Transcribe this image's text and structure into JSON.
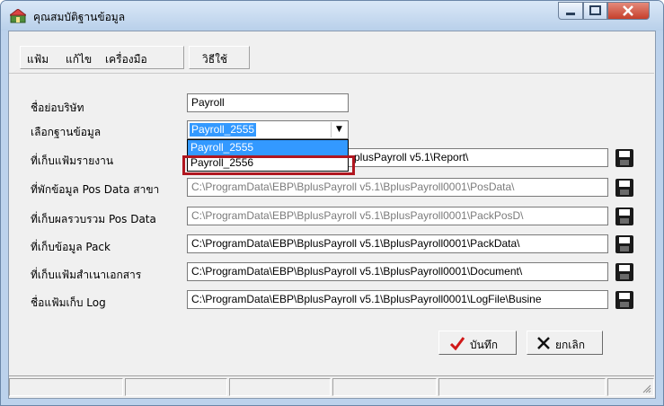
{
  "window": {
    "title": "คุณสมบัติฐานข้อมูล"
  },
  "menu": {
    "file": "แฟ้ม",
    "edit": "แก้ไข",
    "tools": "เครื่องมือ",
    "help": "วิธีใช้"
  },
  "form": {
    "company_label": "ชื่อย่อบริษัท",
    "company_value": "Payroll",
    "db_label": "เลือกฐานข้อมูล",
    "db_selected": "Payroll_2555",
    "db_options": [
      "Payroll_2555",
      "Payroll_2556"
    ],
    "rows": [
      {
        "label": "ที่เก็บแฟ้มรายงาน",
        "value": "C:\\ProgramData\\EBP\\BplusPayroll v5.1\\Report\\",
        "visible_value": "plusPayroll v5.1\\Report\\"
      },
      {
        "label": "ที่พักข้อมูล Pos Data สาขา",
        "value": "C:\\ProgramData\\EBP\\BplusPayroll v5.1\\BplusPayroll0001\\PosData\\"
      },
      {
        "label": "ที่เก็บผลรวบรวม Pos Data",
        "value": "C:\\ProgramData\\EBP\\BplusPayroll v5.1\\BplusPayroll0001\\PackPosD\\"
      },
      {
        "label": "ที่เก็บข้อมูล Pack",
        "value": "C:\\ProgramData\\EBP\\BplusPayroll v5.1\\BplusPayroll0001\\PackData\\"
      },
      {
        "label": "ที่เก็บแฟ้มสำเนาเอกสาร",
        "value": "C:\\ProgramData\\EBP\\BplusPayroll v5.1\\BplusPayroll0001\\Document\\"
      },
      {
        "label": "ชื่อแฟ้มเก็บ Log",
        "value": "C:\\ProgramData\\EBP\\BplusPayroll v5.1\\BplusPayroll0001\\LogFile\\Busine"
      }
    ]
  },
  "buttons": {
    "save": "บันทึก",
    "cancel": "ยกเลิก"
  },
  "colors": {
    "selection": "#3399ff",
    "highlight_box": "#b0161f",
    "save_check": "#d01818"
  }
}
